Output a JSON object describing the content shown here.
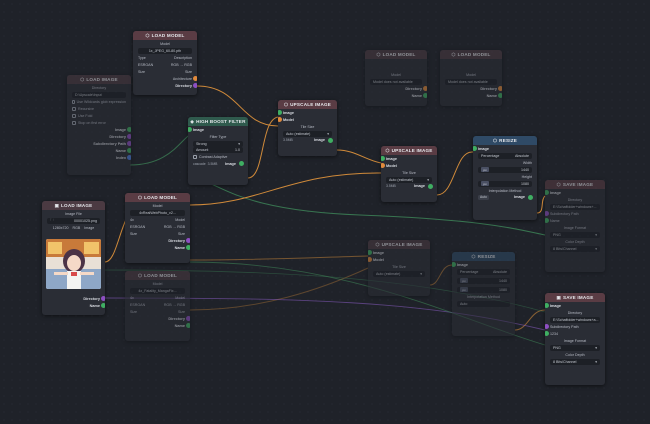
{
  "colors": {
    "load_model": "#5a3c44",
    "load_image": "#4b3a42",
    "high_boost": "#2f5a4d",
    "upscale": "#5a3c44",
    "resize": "#2f4a66",
    "save": "#5a3c44",
    "image_wire": "#3f8a5a",
    "model_wire": "#d58a3a",
    "misc_wire": "#8b5cc4"
  },
  "nodes": {
    "load_model_1": {
      "title": "LOAD MODEL",
      "icon": "node-icon",
      "model_label": "Model",
      "model_value": "1x_JPEG_60-80.pth",
      "rows": [
        [
          "Type",
          "Single",
          "Description",
          ""
        ],
        [
          "ESRGAN",
          "RGB → RGB"
        ],
        [
          "Size",
          "Size"
        ]
      ],
      "arch_label": "Architecture",
      "outputs": [
        "Directory",
        "Name"
      ],
      "out_model": "Model"
    },
    "load_image_1": {
      "title": "LOAD IMAGE",
      "directory_label": "Directory",
      "directory_value": "D:\\Upscale\\Input",
      "options": [
        "Use Wildcards glob expression",
        "Recursive",
        "Use Fold",
        "Stop on first error"
      ],
      "outputs": [
        "Image",
        "Directory",
        "Subdirectory Path",
        "Name",
        "Index"
      ],
      "dim": true
    },
    "high_boost": {
      "title": "HIGH BOOST FILTER",
      "input": "Image",
      "filter_label": "Filter Type",
      "filter_value": "Strong",
      "amount_label": "Amount",
      "amount_value": "1.0",
      "contrast": "Contrast Adaptive",
      "footer_left": "cascade",
      "footer_mid": "3.5MB",
      "out": "Image"
    },
    "upscale_1": {
      "title": "UPSCALE IMAGE",
      "inputs": [
        "Image",
        "Model"
      ],
      "tile_label": "Tile Size",
      "tile_value": "Auto (estimate)",
      "footer_mid": "3.5MB",
      "out": "Image"
    },
    "upscale_2": {
      "title": "UPSCALE IMAGE",
      "inputs": [
        "Image",
        "Model"
      ],
      "tile_label": "Tile Size",
      "tile_value": "Auto (estimate)",
      "footer_mid": "3.5MB",
      "out": "Image"
    },
    "load_model_ghost_a": {
      "title": "LOAD MODEL",
      "model_label": "Model",
      "model_value": "Model does not available",
      "outputs": [
        "Directory",
        "Name"
      ],
      "dim": true
    },
    "load_model_ghost_b": {
      "title": "LOAD MODEL",
      "model_label": "Model",
      "model_value": "Model does not available",
      "outputs": [
        "Directory",
        "Name"
      ],
      "dim": true
    },
    "resize_1": {
      "title": "RESIZE",
      "input": "Image",
      "percentage_label": "Percentage",
      "percentage_value": "Absolute",
      "width_label": "Width",
      "width_value": "1440",
      "height_label": "Height",
      "height_value": "1080",
      "interp_label": "Interpolation Method",
      "interp_value": "Auto",
      "out": "Image"
    },
    "save_image_1": {
      "title": "SAVE IMAGE",
      "inputs": [
        "Image",
        "Directory",
        "Subdirectory Path",
        "Name"
      ],
      "directory_value": "E:\\Schaffolder+windows+...",
      "format_label": "Image Format",
      "format_value": "PNG",
      "depth_label": "Color Depth",
      "depth_value": "8 Bits/Channel",
      "dim": true
    },
    "load_image_2": {
      "title": "LOAD IMAGE",
      "file_label": "Image File",
      "file_value": "00001025.png",
      "meta_left": "1280x720",
      "meta_mid": "RGB",
      "meta_right": "Image",
      "outputs": [
        "Directory",
        "Name"
      ]
    },
    "load_model_2": {
      "title": "LOAD MODEL",
      "model_label": "Model",
      "model_value": "4xRealWebPhoto_v2...",
      "rows": [
        [
          "4x",
          "Model"
        ],
        [
          "ESRGAN",
          "RGB → RGB"
        ],
        [
          "Size",
          "Size"
        ]
      ],
      "outputs": [
        "Directory",
        "Name"
      ],
      "out_model": "Model"
    },
    "load_model_3": {
      "title": "LOAD MODEL",
      "model_label": "Model",
      "model_value": "4x_Fatality_MangaFix...",
      "rows": [
        [
          "4x",
          "Model"
        ],
        [
          "ESRGAN",
          "RGB → RGB"
        ],
        [
          "Size",
          "Size"
        ]
      ],
      "outputs": [
        "Directory",
        "Name"
      ],
      "dim": true
    },
    "upscale_3": {
      "title": "UPSCALE IMAGE",
      "inputs": [
        "Image",
        "Model"
      ],
      "tile_label": "Tile Size",
      "tile_value": "Auto (estimate)",
      "dim": true
    },
    "resize_2": {
      "title": "RESIZE",
      "input": "Image",
      "percentage_label": "Percentage",
      "percentage_value": "Absolute",
      "width_value": "1440",
      "height_value": "1080",
      "interp_label": "Interpolation Method",
      "interp_value": "Auto",
      "dim": true
    },
    "save_image_2": {
      "title": "SAVE IMAGE",
      "inputs": [
        "Image",
        "Directory",
        "Subdirectory Path",
        "Name"
      ],
      "directory_value": "E:\\Schaffolder+windows+a...",
      "name_value": "1234",
      "format_label": "Image Format",
      "format_value": "PNG",
      "depth_label": "Color Depth",
      "depth_value": "8 Bits/Channel"
    }
  }
}
